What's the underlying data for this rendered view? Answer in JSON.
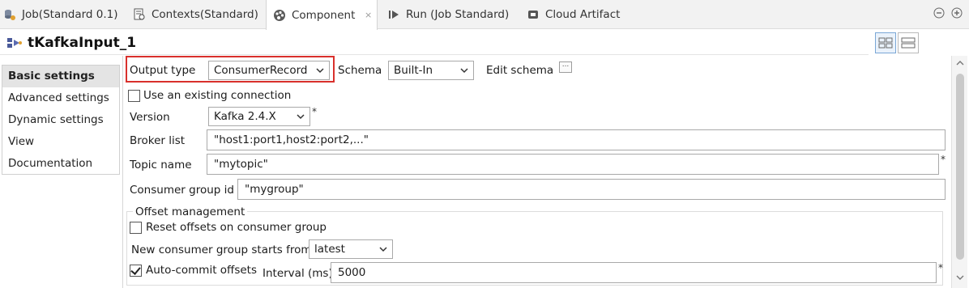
{
  "tabs": [
    {
      "label": "Job(Standard 0.1)",
      "icon": "job-icon"
    },
    {
      "label": "Contexts(Standard)",
      "icon": "contexts-icon"
    },
    {
      "label": "Component",
      "icon": "component-icon",
      "active": true
    },
    {
      "label": "Run (Job Standard)",
      "icon": "run-icon"
    },
    {
      "label": "Cloud Artifact",
      "icon": "cloud-artifact-icon"
    }
  ],
  "component_title": "tKafkaInput_1",
  "sidebar": {
    "items": [
      {
        "label": "Basic settings",
        "active": true
      },
      {
        "label": "Advanced settings"
      },
      {
        "label": "Dynamic settings"
      },
      {
        "label": "View"
      },
      {
        "label": "Documentation"
      }
    ]
  },
  "form": {
    "output_type_label": "Output type",
    "output_type_value": "ConsumerRecord",
    "schema_label": "Schema",
    "schema_value": "Built-In",
    "edit_schema_label": "Edit schema",
    "edit_schema_button": "...",
    "use_existing_connection_label": "Use an existing connection",
    "use_existing_connection_checked": false,
    "version_label": "Version",
    "version_value": "Kafka 2.4.X",
    "broker_list_label": "Broker list",
    "broker_list_value": "\"host1:port1,host2:port2,...\"",
    "topic_name_label": "Topic name",
    "topic_name_value": "\"mytopic\"",
    "consumer_group_label": "Consumer group id",
    "consumer_group_value": "\"mygroup\"",
    "required_marker": "*",
    "offset_group_label": "Offset management",
    "reset_offsets_label": "Reset offsets on consumer group",
    "reset_offsets_checked": false,
    "new_group_starts_label": "New consumer group starts from",
    "new_group_starts_value": "latest",
    "auto_commit_label": "Auto-commit offsets",
    "auto_commit_checked": true,
    "interval_label": "Interval (ms)",
    "interval_value": "5000"
  },
  "colors": {
    "highlight": "#d9302c",
    "active_sidebar": "#e4e4e4",
    "tabbar": "#f2f2f2"
  }
}
